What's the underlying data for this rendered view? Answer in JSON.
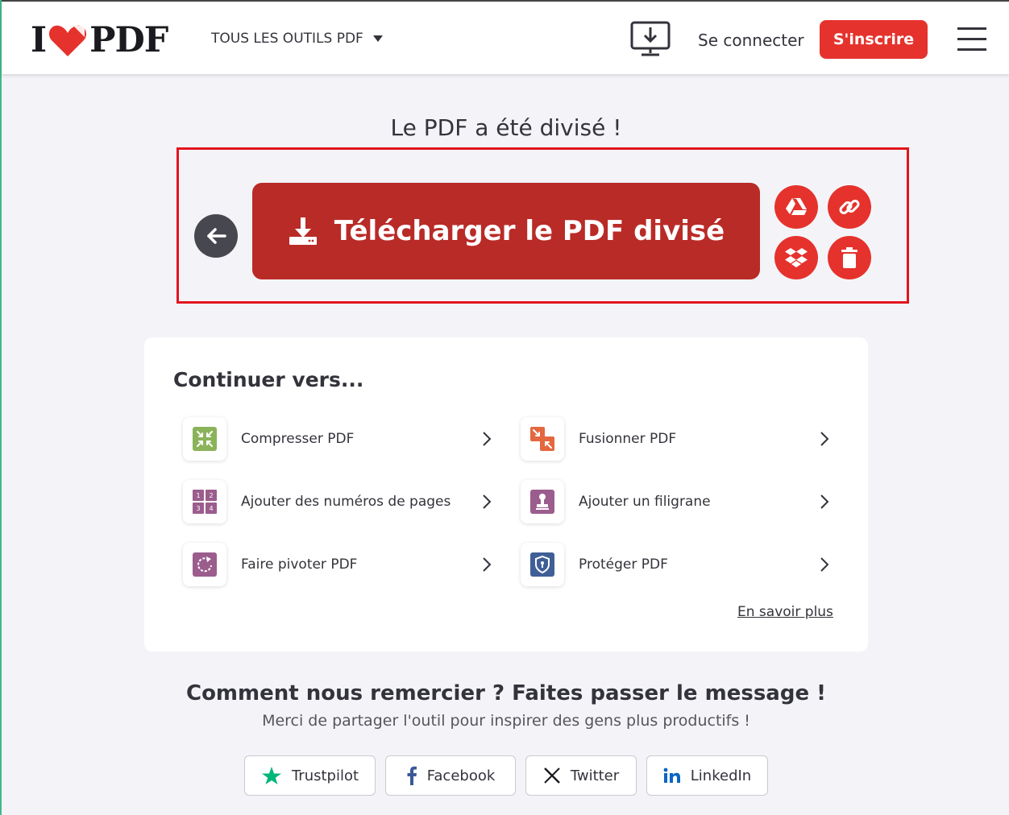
{
  "header": {
    "logo_left": "I",
    "logo_right": "PDF",
    "tools_menu_label": "TOUS LES OUTILS PDF",
    "login_label": "Se connecter",
    "signup_label": "S'inscrire"
  },
  "result": {
    "title": "Le PDF a été divisé !",
    "download_label": "Télécharger le PDF divisé"
  },
  "continue_section": {
    "title": "Continuer vers...",
    "tools": [
      {
        "label": "Compresser PDF",
        "icon": "compress-icon",
        "color": "#8bb35a"
      },
      {
        "label": "Fusionner PDF",
        "icon": "merge-icon",
        "color": "#e4683f"
      },
      {
        "label": "Ajouter des numéros de pages",
        "icon": "page-numbers-icon",
        "color": "#9b5d8d"
      },
      {
        "label": "Ajouter un filigrane",
        "icon": "watermark-icon",
        "color": "#9b5d8d"
      },
      {
        "label": "Faire pivoter PDF",
        "icon": "rotate-icon",
        "color": "#9b5d8d"
      },
      {
        "label": "Protéger PDF",
        "icon": "protect-icon",
        "color": "#3f5f96"
      }
    ],
    "learn_more": "En savoir plus"
  },
  "thanks": {
    "title": "Comment nous remercier ? Faites passer le message !",
    "subtitle": "Merci de partager l'outil pour inspirer des gens plus productifs !"
  },
  "share": {
    "trustpilot": "Trustpilot",
    "facebook": "Facebook",
    "twitter": "Twitter",
    "linkedin": "LinkedIn"
  },
  "colors": {
    "brand_red": "#e5322d",
    "download_red": "#b92b27",
    "highlight_border": "#e3141e",
    "trustpilot_green": "#00b67a",
    "facebook_blue": "#3b5998",
    "linkedin_blue": "#0a66c2"
  }
}
